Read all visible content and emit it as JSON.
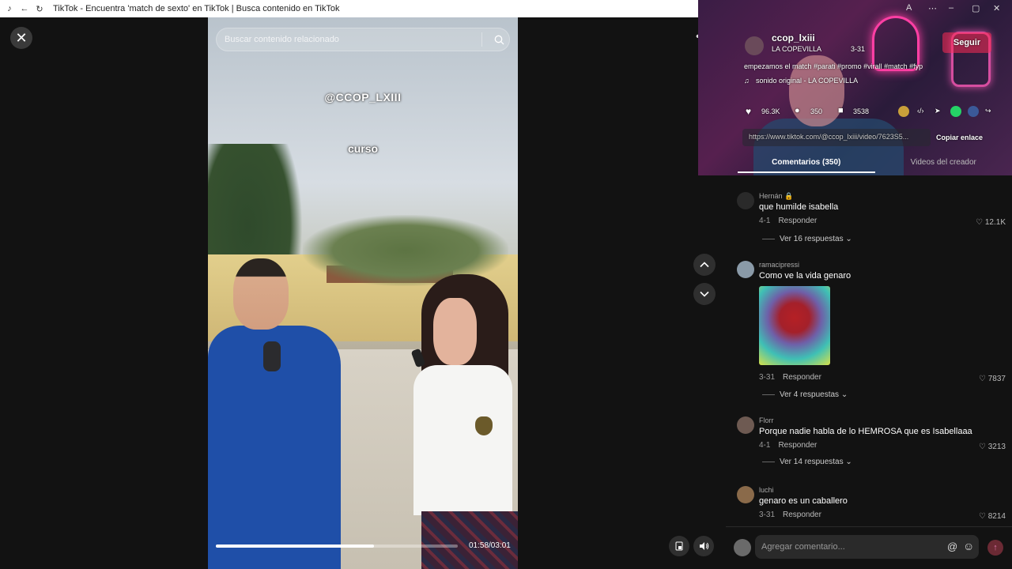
{
  "window": {
    "title": "TikTok - Encuentra 'match de sexto' en TikTok | Busca contenido en TikTok"
  },
  "video": {
    "search_placeholder": "Buscar contenido relacionado",
    "overlay_handle": "@CCOP_LXIII",
    "overlay_caption": "curso",
    "time": "01:58/03:01",
    "progress_fraction": 0.652
  },
  "post": {
    "username": "ccop_lxiii",
    "display": "LA COPEVILLA",
    "date": "3-31",
    "follow_label": "Seguir",
    "caption": "empezamos el match #parati #promo #virall #match #fyp",
    "sound": "sonido original - LA COPEVILLA",
    "likes": "96.3K",
    "comments_count": "350",
    "saves": "3538",
    "link": "https://www.tiktok.com/@ccop_lxiii/video/7623S5...",
    "copy_label": "Copiar enlace"
  },
  "tabs": [
    {
      "label": "Comentarios (350)"
    },
    {
      "label": "Videos del creador"
    }
  ],
  "comments": [
    {
      "user": "Hernán 🔒",
      "text": "que humilde isabella",
      "date": "4-1",
      "reply": "Responder",
      "likes": "12.1K",
      "replies": "Ver 16 respuestas"
    },
    {
      "user": "ramacipressi",
      "text": "Como ve la vida genaro",
      "date": "3-31",
      "reply": "Responder",
      "likes": "7837",
      "replies": "Ver 4 respuestas"
    },
    {
      "user": "Florr",
      "text": "Porque nadie habla de lo HEMROSA que es Isabellaaa",
      "date": "4-1",
      "reply": "Responder",
      "likes": "3213",
      "replies": "Ver 14 respuestas"
    },
    {
      "user": "luchi",
      "text": "genaro es un caballero",
      "date": "3-31",
      "reply": "Responder",
      "likes": "8214"
    }
  ],
  "composer": {
    "placeholder": "Agregar comentario..."
  },
  "colors": {
    "accent": "#fe2c55",
    "background": "#121212"
  }
}
